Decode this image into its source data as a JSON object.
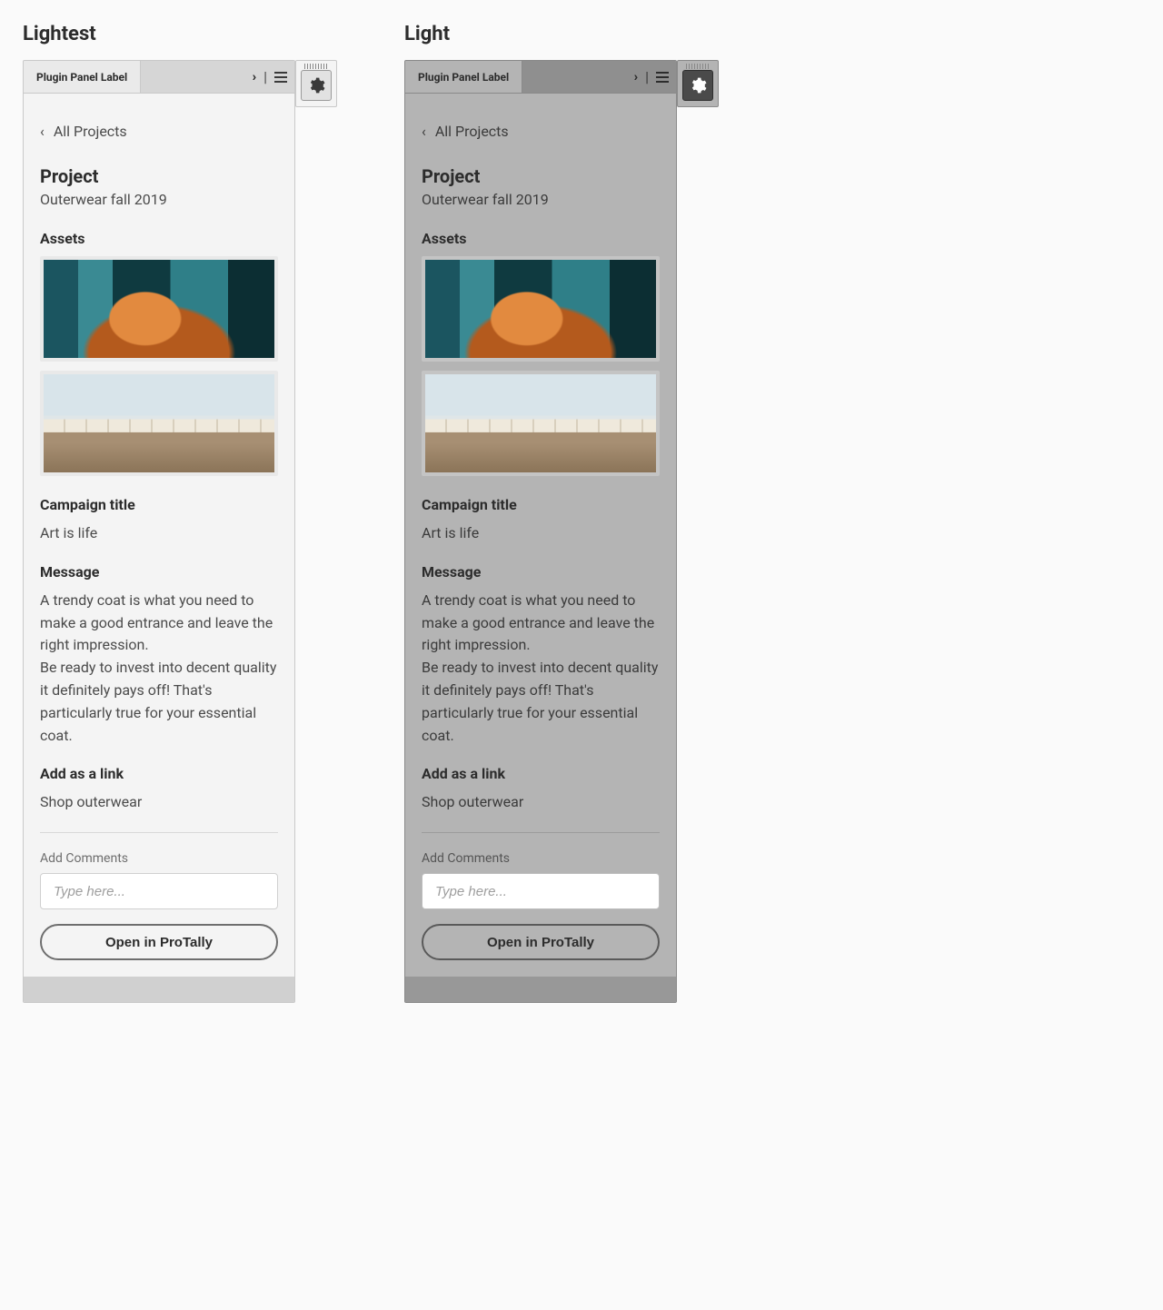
{
  "variants": {
    "lightest": "Lightest",
    "light": "Light"
  },
  "panel": {
    "tab_label": "Plugin Panel Label",
    "back_link": "All Projects",
    "project_heading": "Project",
    "project_name": "Outerwear fall 2019",
    "assets_heading": "Assets",
    "campaign_title_label": "Campaign title",
    "campaign_title_value": "Art is life",
    "message_label": "Message",
    "message_value": "A trendy coat is what you need to make a good entrance and leave the right impression.\nBe ready to invest into decent quality it definitely pays off! That's particularly true for your essential coat.",
    "link_label": "Add as a link",
    "link_value": "Shop outerwear",
    "comments_label": "Add Comments",
    "comments_placeholder": "Type here...",
    "open_button": "Open in ProTally"
  }
}
